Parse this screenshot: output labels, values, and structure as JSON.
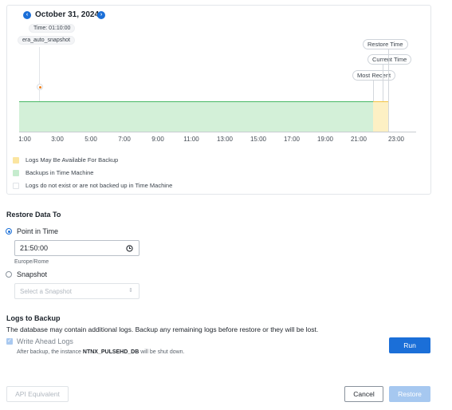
{
  "timeline": {
    "date": "October 31, 2024",
    "prev_icon": "chevron-left-icon",
    "next_icon": "chevron-right-icon",
    "time_chip": "Time: 01:10:00",
    "snapshot_chip": "era_auto_snapshot",
    "markers": {
      "restore_time": "Restore Time",
      "current_time": "Current Time",
      "most_recent": "Most Recent"
    },
    "axis_ticks": [
      "1:00",
      "3:00",
      "5:00",
      "7:00",
      "9:00",
      "11:00",
      "13:00",
      "15:00",
      "17:00",
      "19:00",
      "21:00",
      "23:00"
    ],
    "legend": [
      {
        "label": "Logs May Be Available For Backup",
        "color": "#fbe5a0"
      },
      {
        "label": "Backups in Time Machine",
        "color": "#c6ecce"
      },
      {
        "label": "Logs do not exist or are not backed up in Time Machine",
        "color": "#ffffff"
      }
    ],
    "colors": {
      "green": "#47b764",
      "yellow": "#f3c443",
      "snapshot": "#f07e1a"
    }
  },
  "restore": {
    "title": "Restore Data To",
    "point_in_time_label": "Point in Time",
    "time_value": "21:50:00",
    "clock_icon": "clock-icon",
    "timezone": "Europe/Rome",
    "snapshot_label": "Snapshot",
    "snapshot_placeholder": "Select a Snapshot",
    "dropdown_icon": "chevron-updown-icon"
  },
  "logs": {
    "title": "Logs to Backup",
    "description": "The database may contain additional logs. Backup any remaining logs before restore or they will be lost.",
    "checkbox_label": "Write Ahead Logs",
    "note_prefix": "After backup, the instance ",
    "instance_name": "NTNX_PULSEHD_DB",
    "note_suffix": " will be shut down.",
    "run_label": "Run"
  },
  "footer": {
    "api_label": "API Equivalent",
    "cancel_label": "Cancel",
    "restore_label": "Restore"
  },
  "colors": {
    "accent": "#1b6fd8"
  }
}
